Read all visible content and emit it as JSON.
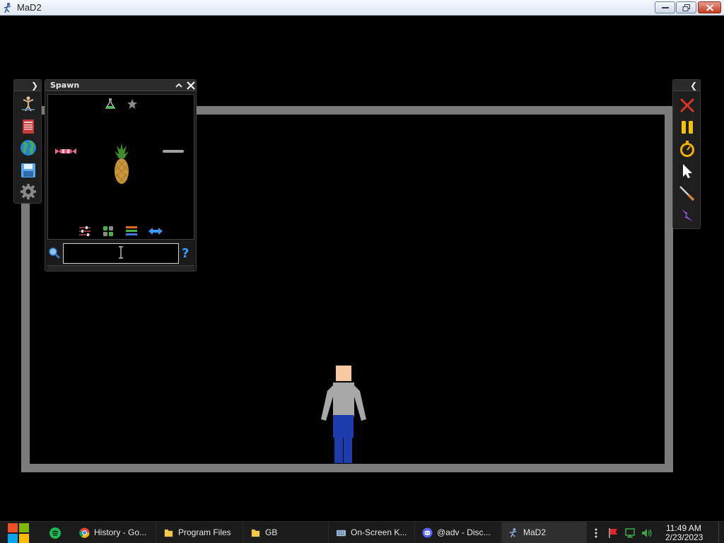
{
  "window": {
    "title": "MaD2"
  },
  "left_toolbar": {
    "items": [
      {
        "icon": "ragdoll-icon"
      },
      {
        "icon": "book-icon"
      },
      {
        "icon": "globe-icon"
      },
      {
        "icon": "save-icon"
      },
      {
        "icon": "settings-gear-icon"
      }
    ]
  },
  "spawn": {
    "title": "Spawn",
    "tabs": [
      {
        "icon": "flask-icon"
      },
      {
        "icon": "star-icon"
      }
    ],
    "items": [
      {
        "icon": "candy-icon"
      },
      {
        "icon": "pineapple-icon"
      },
      {
        "icon": "bar-icon"
      }
    ],
    "view_modes": [
      {
        "icon": "filter-sliders-icon"
      },
      {
        "icon": "grid-view-icon"
      },
      {
        "icon": "list-view-icon"
      },
      {
        "icon": "swap-arrows-icon"
      }
    ],
    "search": {
      "value": "",
      "placeholder": ""
    },
    "help_label": "?"
  },
  "right_toolbar": {
    "items": [
      {
        "icon": "delete-x-icon",
        "color": "#d9342a"
      },
      {
        "icon": "pause-icon",
        "color": "#f2c200"
      },
      {
        "icon": "stopwatch-icon",
        "color": "#f2b300"
      },
      {
        "icon": "cursor-icon",
        "color": "#ffffff"
      },
      {
        "icon": "knife-icon",
        "color": "#d88030"
      },
      {
        "icon": "lightning-icon",
        "color": "#a05be0"
      }
    ]
  },
  "colors": {
    "arena_wall": "#7b7b7b",
    "background": "#000000",
    "character_skin": "#f8c8a0",
    "character_shirt": "#a8a8a8",
    "character_pants": "#1c3cac"
  },
  "taskbar": {
    "items": [
      {
        "label": "History - Go...",
        "icon": "chrome-icon"
      },
      {
        "label": "Program Files",
        "icon": "folder-icon"
      },
      {
        "label": "GB",
        "icon": "folder-icon"
      },
      {
        "label": "On-Screen K...",
        "icon": "keyboard-icon"
      },
      {
        "label": "@adv - Disc...",
        "icon": "discord-icon"
      },
      {
        "label": "MaD2",
        "icon": "mad2-icon"
      }
    ],
    "clock_time": "11:49 AM",
    "clock_date": "2/23/2023"
  }
}
